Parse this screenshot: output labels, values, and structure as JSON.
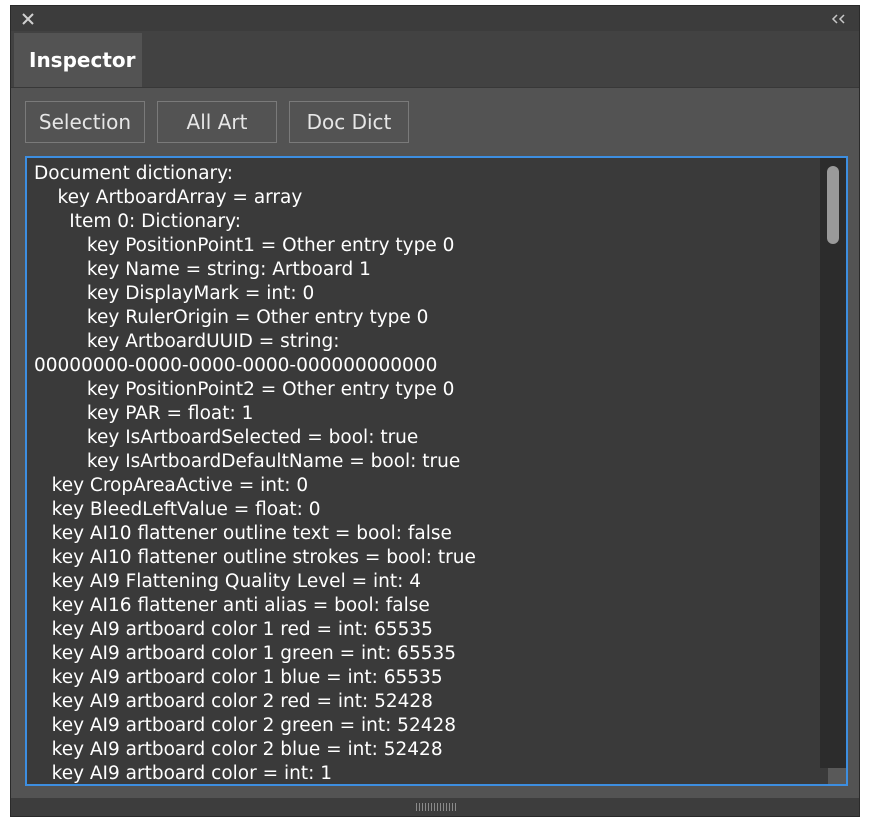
{
  "window": {
    "close_icon": "close-icon",
    "collapse_icon": "double-chevron-left-icon"
  },
  "tabs": [
    {
      "label": "Inspector",
      "active": true
    }
  ],
  "toolbar": {
    "selection_label": "Selection",
    "all_art_label": "All Art",
    "doc_dict_label": "Doc Dict"
  },
  "output": {
    "lines": [
      "Document dictionary:",
      "    key ArtboardArray = array",
      "      Item 0: Dictionary:",
      "         key PositionPoint1 = Other entry type 0",
      "         key Name = string: Artboard 1",
      "         key DisplayMark = int: 0",
      "         key RulerOrigin = Other entry type 0",
      "         key ArtboardUUID = string:",
      "00000000-0000-0000-0000-000000000000",
      "         key PositionPoint2 = Other entry type 0",
      "         key PAR = float: 1",
      "         key IsArtboardSelected = bool: true",
      "         key IsArtboardDefaultName = bool: true",
      "   key CropAreaActive = int: 0",
      "   key BleedLeftValue = float: 0",
      "   key AI10 flattener outline text = bool: false",
      "   key AI10 flattener outline strokes = bool: true",
      "   key AI9 Flattening Quality Level = int: 4",
      "   key AI16 flattener anti alias = bool: false",
      "   key AI9 artboard color 1 red = int: 65535",
      "   key AI9 artboard color 1 green = int: 65535",
      "   key AI9 artboard color 1 blue = int: 65535",
      "   key AI9 artboard color 2 red = int: 52428",
      "   key AI9 artboard color 2 green = int: 52428",
      "   key AI9 artboard color 2 blue = int: 52428",
      "   key AI9 artboard color = int: 1"
    ]
  },
  "colors": {
    "panel_bg": "#535353",
    "focus_border": "#3d8ee0",
    "text": "#ffffff"
  }
}
